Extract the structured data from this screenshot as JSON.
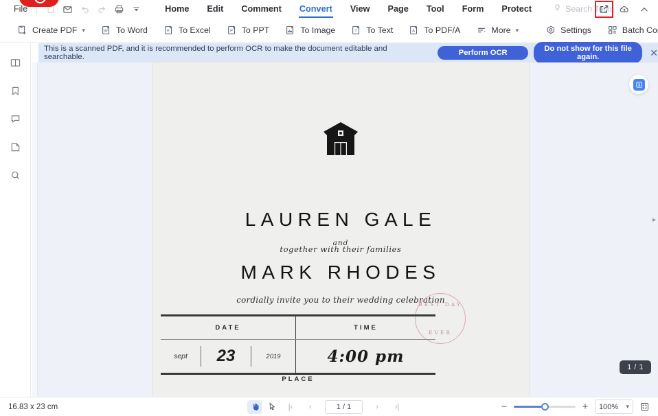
{
  "menubar": {
    "file_label": "File",
    "quick_icons": [
      {
        "name": "new-document-icon",
        "glyph": "doc"
      },
      {
        "name": "email-icon",
        "glyph": "mail"
      },
      {
        "name": "undo-icon",
        "glyph": "undo"
      },
      {
        "name": "redo-icon",
        "glyph": "redo"
      },
      {
        "name": "print-icon",
        "glyph": "print"
      },
      {
        "name": "quick-access-dropdown-icon",
        "glyph": "chevron"
      }
    ],
    "tabs": [
      {
        "label": "Home",
        "active": false
      },
      {
        "label": "Edit",
        "active": false
      },
      {
        "label": "Comment",
        "active": false
      },
      {
        "label": "Convert",
        "active": true
      },
      {
        "label": "View",
        "active": false
      },
      {
        "label": "Page",
        "active": false
      },
      {
        "label": "Tool",
        "active": false
      },
      {
        "label": "Form",
        "active": false
      },
      {
        "label": "Protect",
        "active": false
      }
    ],
    "search_placeholder": "Search Tools",
    "right_icons": [
      {
        "name": "share-export-icon",
        "highlighted": true
      },
      {
        "name": "cloud-upload-icon",
        "highlighted": false
      },
      {
        "name": "collapse-ribbon-icon",
        "highlighted": false
      }
    ],
    "highlight_color": "#e02424",
    "accent_color": "#2c6ed5"
  },
  "ribbon": {
    "items": [
      {
        "label": "Create PDF",
        "icon": "create-pdf-icon",
        "caret": true
      },
      {
        "label": "To Word",
        "icon": "to-word-icon",
        "caret": false
      },
      {
        "label": "To Excel",
        "icon": "to-excel-icon",
        "caret": false
      },
      {
        "label": "To PPT",
        "icon": "to-ppt-icon",
        "caret": false
      },
      {
        "label": "To Image",
        "icon": "to-image-icon",
        "caret": false
      },
      {
        "label": "To Text",
        "icon": "to-text-icon",
        "caret": false
      },
      {
        "label": "To PDF/A",
        "icon": "to-pdfa-icon",
        "caret": false
      },
      {
        "label": "More",
        "icon": "more-icon",
        "caret": true
      }
    ],
    "settings_label": "Settings",
    "batch_label": "Batch Conve"
  },
  "notification": {
    "message": "This is a scanned PDF, and it is recommended to perform OCR to make the document editable and searchable.",
    "primary_button": "Perform OCR",
    "secondary_button": "Do not show for this file again.",
    "close": "✕",
    "bg_color": "#dbe6f7",
    "button_color": "#4062d8"
  },
  "sidebar": {
    "items": [
      {
        "name": "thumbnails-panel-icon",
        "label": "Thumbnails"
      },
      {
        "name": "bookmark-panel-icon",
        "label": "Bookmarks"
      },
      {
        "name": "comment-panel-icon",
        "label": "Comments"
      },
      {
        "name": "attachment-panel-icon",
        "label": "Attachments"
      },
      {
        "name": "search-panel-icon",
        "label": "Search"
      }
    ]
  },
  "viewer": {
    "ai_button_label": "⌘",
    "page_badge": "1 / 1",
    "page_bg": "#efefee"
  },
  "document": {
    "together_line": "together with their families",
    "name_1": "LAUREN GALE",
    "and_line": "and",
    "name_2": "MARK RHODES",
    "cordially_line": "cordially invite you to their wedding celebration",
    "stamp_top": "BEST DAY",
    "stamp_bottom": "EVER",
    "stamp_color": "#c98f96",
    "table": {
      "header_date": "DATE",
      "header_time": "TIME",
      "month": "sept",
      "day": "23",
      "year": "2019",
      "time": "4:00 pm"
    },
    "place_label": "PLACE"
  },
  "statusbar": {
    "page_dimensions": "16.83 x 23 cm",
    "tools": [
      {
        "name": "hand-tool-icon",
        "active": true
      },
      {
        "name": "select-tool-icon",
        "active": false
      }
    ],
    "nav": {
      "first": "|‹",
      "prev": "‹",
      "next": "›",
      "last": "›|"
    },
    "page_value": "1 / 1",
    "zoom_minus": "−",
    "zoom_plus": "+",
    "zoom_value": "100%",
    "zoom_caret": "⌄",
    "fit_page_icon": "fit-page-icon"
  }
}
